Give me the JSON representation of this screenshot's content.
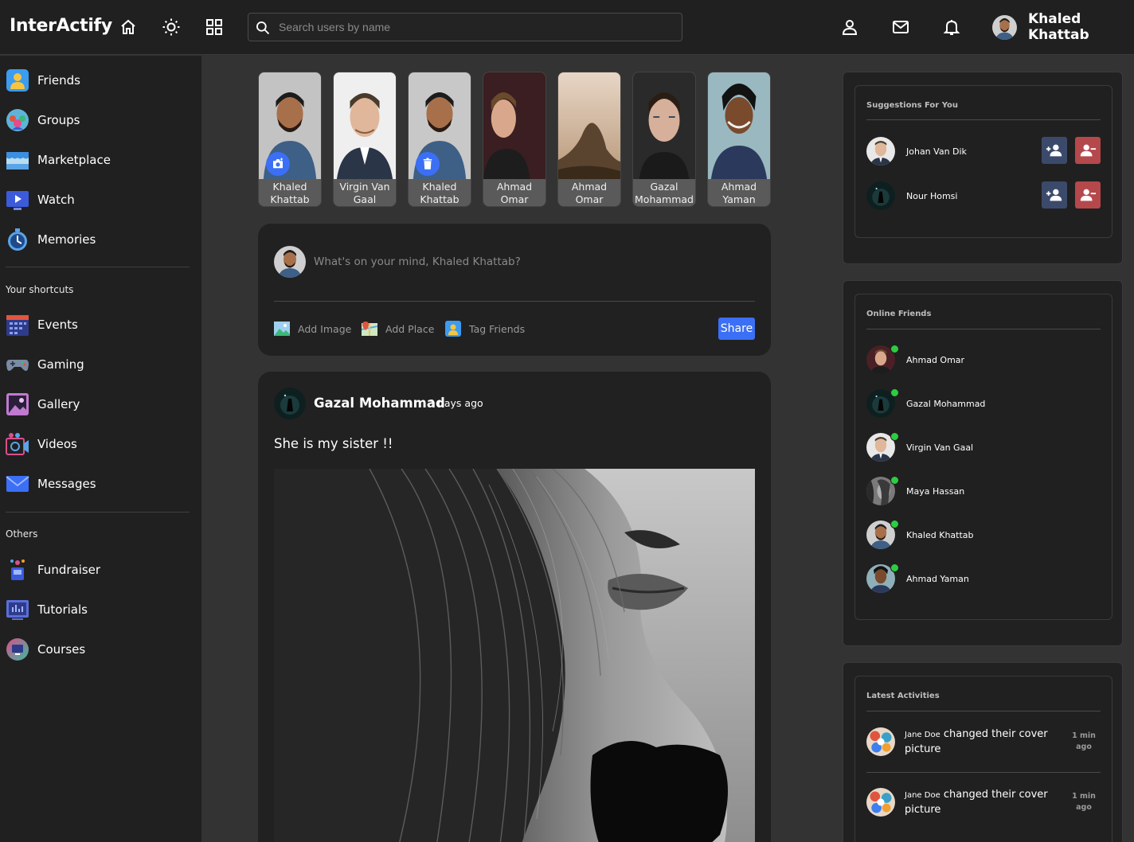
{
  "app": {
    "logo": "InterActify"
  },
  "topbar": {
    "search_placeholder": "Search users by name",
    "user_name": "Khaled Khattab",
    "icons": [
      "home-icon",
      "sun-icon",
      "grid-icon",
      "person-icon",
      "mail-icon",
      "bell-icon"
    ]
  },
  "sidebar": {
    "main": [
      {
        "label": "Friends",
        "icon": "friends-icon"
      },
      {
        "label": "Groups",
        "icon": "groups-icon"
      },
      {
        "label": "Marketplace",
        "icon": "marketplace-icon"
      },
      {
        "label": "Watch",
        "icon": "watch-icon"
      },
      {
        "label": "Memories",
        "icon": "memories-icon"
      }
    ],
    "shortcuts_heading": "Your shortcuts",
    "shortcuts": [
      {
        "label": "Events",
        "icon": "events-icon"
      },
      {
        "label": "Gaming",
        "icon": "gaming-icon"
      },
      {
        "label": "Gallery",
        "icon": "gallery-icon"
      },
      {
        "label": "Videos",
        "icon": "videos-icon"
      },
      {
        "label": "Messages",
        "icon": "messages-icon"
      }
    ],
    "others_heading": "Others",
    "others": [
      {
        "label": "Fundraiser",
        "icon": "fundraiser-icon"
      },
      {
        "label": "Tutorials",
        "icon": "tutorials-icon"
      },
      {
        "label": "Courses",
        "icon": "courses-icon"
      }
    ]
  },
  "stories": [
    {
      "line1": "Khaled",
      "line2": "Khattab",
      "badge": "camera-icon"
    },
    {
      "line1": "Virgin Van",
      "line2": "Gaal"
    },
    {
      "line1": "Khaled",
      "line2": "Khattab",
      "badge": "trash-icon"
    },
    {
      "line1": "Ahmad",
      "line2": "Omar"
    },
    {
      "line1": "Ahmad",
      "line2": "Omar"
    },
    {
      "line1": "Gazal",
      "line2": "Mohammad"
    },
    {
      "line1": "Ahmad",
      "line2": "Yaman"
    }
  ],
  "composer": {
    "placeholder": "What's on your mind, Khaled Khattab?",
    "actions": [
      "Add Image",
      "Add Place",
      "Tag Friends"
    ],
    "share_label": "Share"
  },
  "post": {
    "author": "Gazal Mohammad",
    "time": "3 days ago",
    "text": "She is my sister !!"
  },
  "suggestions": {
    "title": "Suggestions For You",
    "items": [
      "Johan Van Dik",
      "Nour Homsi"
    ]
  },
  "online_friends": {
    "title": "Online Friends",
    "items": [
      "Ahmad Omar",
      "Gazal Mohammad",
      "Virgin Van Gaal",
      "Maya Hassan",
      "Khaled Khattab",
      "Ahmad Yaman"
    ]
  },
  "activities": {
    "title": "Latest Activities",
    "items": [
      {
        "who": "Jane Doe",
        "what": "changed their cover picture",
        "time_line1": "1 min",
        "time_line2": "ago"
      },
      {
        "who": "Jane Doe",
        "what": "changed their cover picture",
        "time_line1": "1 min",
        "time_line2": "ago"
      }
    ]
  },
  "colors": {
    "accent": "#3b6ff5",
    "online": "#2ecc40",
    "accept": "#3b4a6b",
    "decline": "#b5484b"
  }
}
